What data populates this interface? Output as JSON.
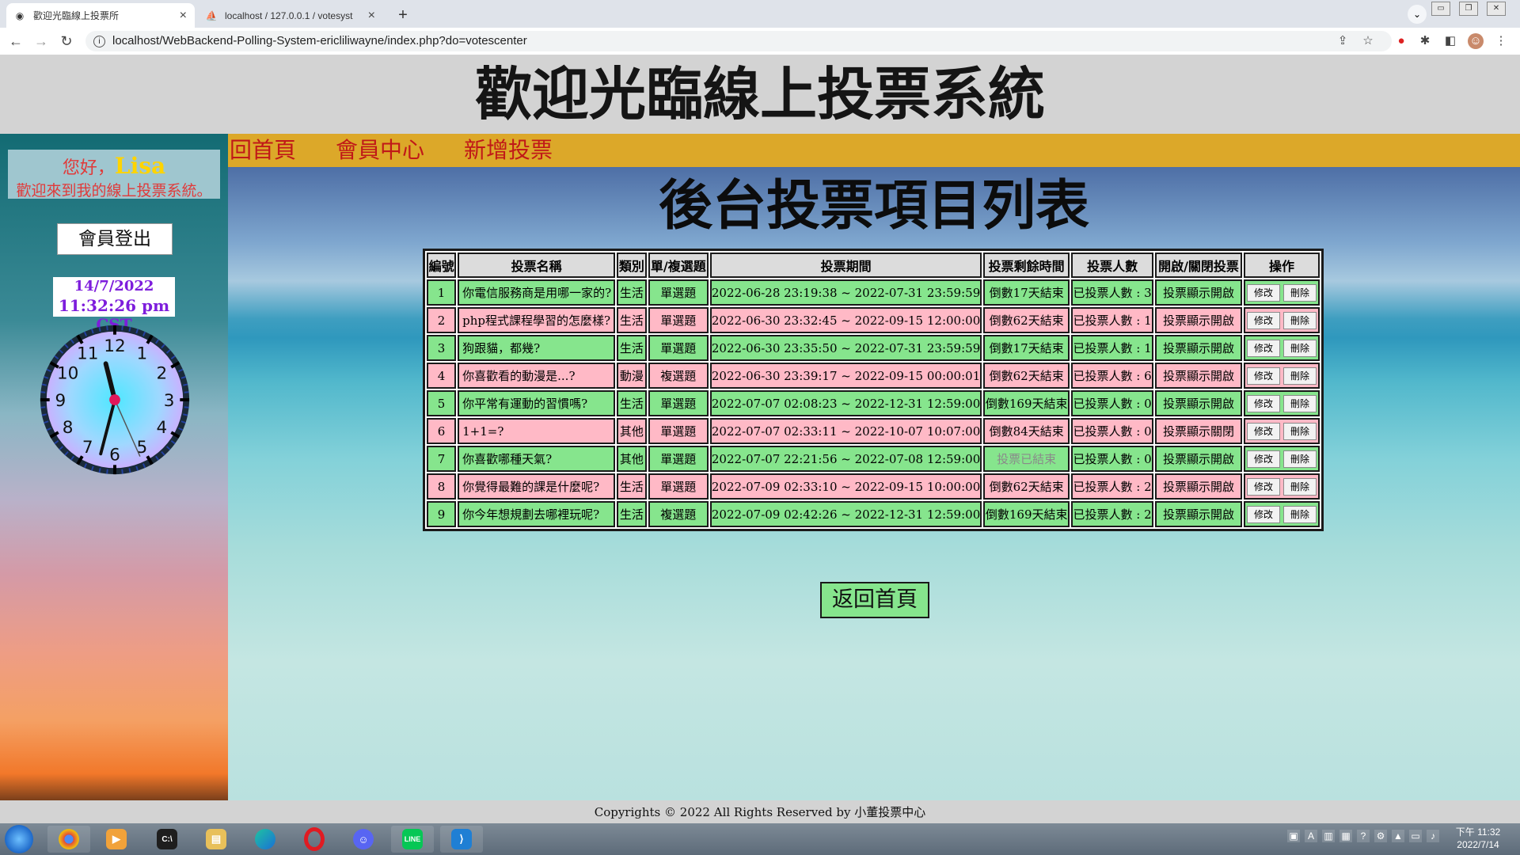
{
  "browser": {
    "tabs": [
      {
        "title": "歡迎光臨線上投票所",
        "active": true
      },
      {
        "title": "localhost / 127.0.0.1 / votesyst",
        "active": false
      }
    ],
    "new_tab": "+",
    "url": "localhost/WebBackend-Polling-System-ericliliwayne/index.php?do=votescenter"
  },
  "header": {
    "title": "歡迎光臨線上投票系統"
  },
  "sidebar": {
    "greeting": "您好，",
    "username": "Lisa",
    "welcome": "歡迎來到我的線上投票系統。",
    "logout": "會員登出",
    "date": "14/7/2022",
    "time": "11:32:26 pm CST",
    "clock": {
      "hour": 11,
      "minute": 32,
      "second": 26,
      "numbers": [
        "12",
        "1",
        "2",
        "3",
        "4",
        "5",
        "6",
        "7",
        "8",
        "9",
        "10",
        "11"
      ]
    }
  },
  "nav": {
    "items": [
      "回首頁",
      "會員中心",
      "新增投票"
    ]
  },
  "main": {
    "heading": "後台投票項目列表",
    "headers": [
      "編號",
      "投票名稱",
      "類別",
      "單/複選題",
      "投票期間",
      "投票剩餘時間",
      "投票人數",
      "開啟/關閉投票",
      "操作"
    ],
    "rows": [
      {
        "id": "1",
        "name": "你電信服務商是用哪一家的?",
        "category": "生活",
        "type": "單選題",
        "period": "2022-06-28 23:19:38 ~ 2022-07-31 23:59:59",
        "remaining": "倒數17天結束",
        "voters": "已投票人數 : 3",
        "status": "投票顯示開啟",
        "ended": false
      },
      {
        "id": "2",
        "name": "php程式課程學習的怎麼樣?",
        "category": "生活",
        "type": "單選題",
        "period": "2022-06-30 23:32:45 ~ 2022-09-15 12:00:00",
        "remaining": "倒數62天結束",
        "voters": "已投票人數 : 1",
        "status": "投票顯示開啟",
        "ended": false
      },
      {
        "id": "3",
        "name": "狗跟貓，都幾?",
        "category": "生活",
        "type": "單選題",
        "period": "2022-06-30 23:35:50 ~ 2022-07-31 23:59:59",
        "remaining": "倒數17天結束",
        "voters": "已投票人數 : 1",
        "status": "投票顯示開啟",
        "ended": false
      },
      {
        "id": "4",
        "name": "你喜歡看的動漫是...?",
        "category": "動漫",
        "type": "複選題",
        "period": "2022-06-30 23:39:17 ~ 2022-09-15 00:00:01",
        "remaining": "倒數62天結束",
        "voters": "已投票人數 : 6",
        "status": "投票顯示開啟",
        "ended": false
      },
      {
        "id": "5",
        "name": "你平常有運動的習慣嗎?",
        "category": "生活",
        "type": "單選題",
        "period": "2022-07-07 02:08:23 ~ 2022-12-31 12:59:00",
        "remaining": "倒數169天結束",
        "voters": "已投票人數 : 0",
        "status": "投票顯示開啟",
        "ended": false
      },
      {
        "id": "6",
        "name": "1+1=?",
        "category": "其他",
        "type": "單選題",
        "period": "2022-07-07 02:33:11 ~ 2022-10-07 10:07:00",
        "remaining": "倒數84天結束",
        "voters": "已投票人數 : 0",
        "status": "投票顯示關閉",
        "ended": false
      },
      {
        "id": "7",
        "name": "你喜歡哪種天氣?",
        "category": "其他",
        "type": "單選題",
        "period": "2022-07-07 22:21:56 ~ 2022-07-08 12:59:00",
        "remaining": "投票已結束",
        "voters": "已投票人數 : 0",
        "status": "投票顯示開啟",
        "ended": true
      },
      {
        "id": "8",
        "name": "你覺得最難的課是什麼呢?",
        "category": "生活",
        "type": "單選題",
        "period": "2022-07-09 02:33:10 ~ 2022-09-15 10:00:00",
        "remaining": "倒數62天結束",
        "voters": "已投票人數 : 2",
        "status": "投票顯示開啟",
        "ended": false
      },
      {
        "id": "9",
        "name": "你今年想規劃去哪裡玩呢?",
        "category": "生活",
        "type": "複選題",
        "period": "2022-07-09 02:42:26 ~ 2022-12-31 12:59:00",
        "remaining": "倒數169天結束",
        "voters": "已投票人數 : 2",
        "status": "投票顯示開啟",
        "ended": false
      }
    ],
    "edit_label": "修改",
    "delete_label": "刪除",
    "back_home": "返回首頁"
  },
  "footer": {
    "text": "Copyrights © 2022 All Rights Reserved by 小董投票中心"
  },
  "taskbar": {
    "apps": [
      "chrome",
      "media-player",
      "terminal",
      "file-explorer",
      "edge",
      "opera",
      "discord",
      "line",
      "vscode"
    ],
    "time": "下午 11:32",
    "date": "2022/7/14"
  },
  "colors": {
    "row_green": "#86e58d",
    "row_pink": "#ffb9c6",
    "nav_bar": "#dca829",
    "nav_text": "#c01818",
    "greeting_text": "#e03a3a",
    "username": "#ffd400",
    "datetime_text": "#7d1ddc"
  }
}
